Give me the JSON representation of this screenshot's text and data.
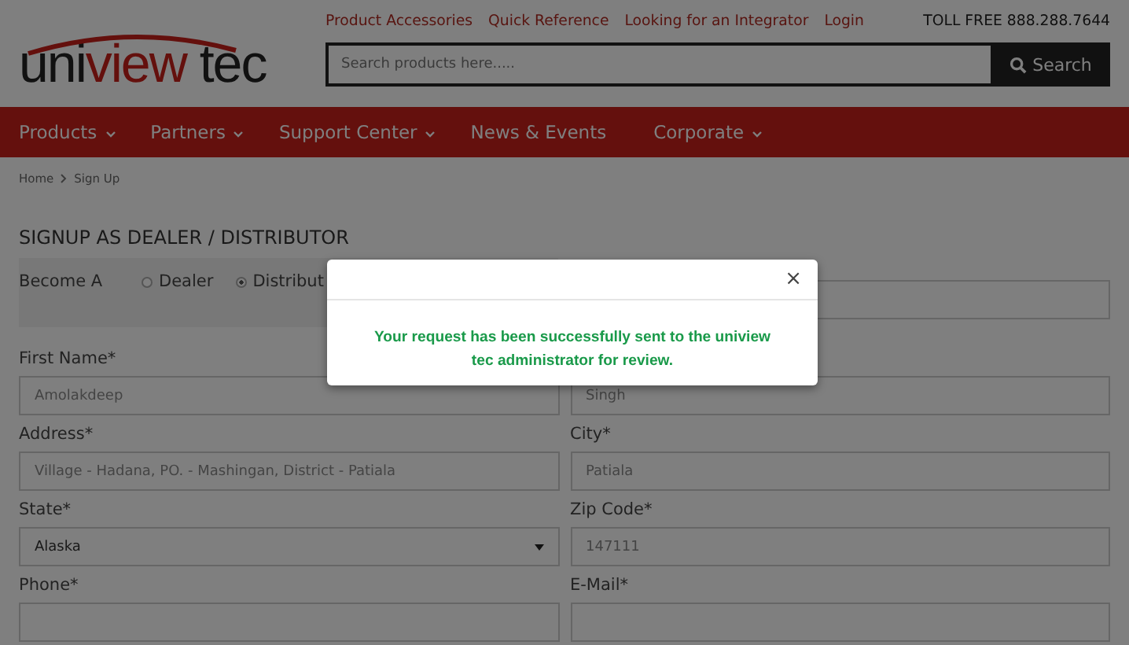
{
  "header": {
    "logo": [
      {
        "text": "uni",
        "accent": false
      },
      {
        "text": "view",
        "accent": true
      },
      {
        "text": " tec",
        "accent": false
      }
    ],
    "top_links": [
      "Product Accessories",
      "Quick Reference",
      "Looking for an Integrator",
      "Login"
    ],
    "toll_free": "TOLL FREE 888.288.7644",
    "search": {
      "placeholder": "Search products here.....",
      "button": "Search"
    }
  },
  "nav": [
    {
      "label": "Products",
      "dropdown": true
    },
    {
      "label": "Partners",
      "dropdown": true
    },
    {
      "label": "Support Center",
      "dropdown": true
    },
    {
      "label": "News & Events",
      "dropdown": false
    },
    {
      "label": "Corporate",
      "dropdown": true
    }
  ],
  "breadcrumb": [
    "Home",
    "Sign Up"
  ],
  "form": {
    "title": "SIGNUP AS DEALER / DISTRIBUTOR",
    "become": {
      "label": "Become A",
      "options": [
        {
          "label": "Dealer",
          "selected": false
        },
        {
          "label": "Distribut",
          "selected": true
        }
      ]
    },
    "rows": [
      [
        {
          "label": "First Name*",
          "value": "Amolakdeep",
          "kind": "text"
        },
        {
          "value": "Singh",
          "kind": "text"
        }
      ],
      [
        {
          "label": "Address*",
          "value": "Village - Hadana, PO. - Mashingan, District - Patiala",
          "kind": "text"
        },
        {
          "label": "City*",
          "value": "Patiala",
          "kind": "text"
        }
      ],
      [
        {
          "label": "State*",
          "value": "Alaska",
          "kind": "select"
        },
        {
          "label": "Zip Code*",
          "value": "147111",
          "kind": "text"
        }
      ],
      [
        {
          "label": "Phone*",
          "kind": "text"
        },
        {
          "label": "E-Mail*",
          "kind": "text"
        }
      ]
    ]
  },
  "modal": {
    "message": "Your request has been successfully sent to the uniview tec administrator for review.",
    "close": "×"
  }
}
